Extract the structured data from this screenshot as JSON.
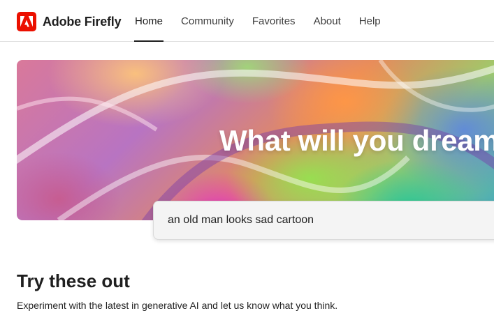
{
  "brand": {
    "name": "Adobe Firefly",
    "logo_icon": "adobe-a-icon",
    "accent": "#eb1000"
  },
  "nav": {
    "items": [
      {
        "label": "Home",
        "active": true
      },
      {
        "label": "Community",
        "active": false
      },
      {
        "label": "Favorites",
        "active": false
      },
      {
        "label": "About",
        "active": false
      },
      {
        "label": "Help",
        "active": false
      }
    ]
  },
  "hero": {
    "title": "What will you dream",
    "prompt_value": "an old man looks sad cartoon"
  },
  "section": {
    "title": "Try these out",
    "subtitle": "Experiment with the latest in generative AI and let us know what you think."
  }
}
